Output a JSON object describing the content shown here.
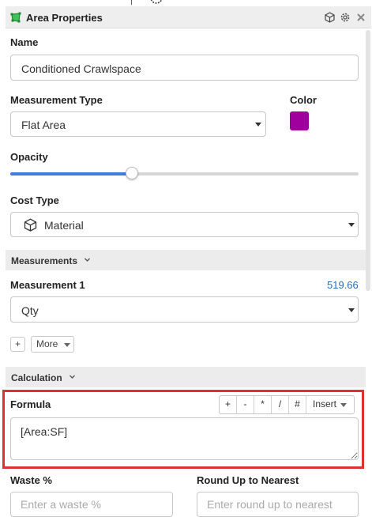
{
  "panel": {
    "title": "Area Properties",
    "title_icon": "area-shape-icon",
    "header_icons": [
      "cube-icon",
      "gear-icon",
      "close-icon"
    ],
    "title_icon_color": "#2fb24a"
  },
  "name": {
    "label": "Name",
    "value": "Conditioned Crawlspace"
  },
  "measurement_type": {
    "label": "Measurement Type",
    "selected": "Flat Area"
  },
  "color": {
    "label": "Color",
    "swatch": "#a0009e"
  },
  "opacity": {
    "label": "Opacity",
    "level": 0.35,
    "accent": "#3b7de0"
  },
  "cost_type": {
    "label": "Cost Type",
    "selected": "Material",
    "icon": "cube-outline-icon"
  },
  "measurements_section": {
    "title": "Measurements"
  },
  "measurement1": {
    "label": "Measurement 1",
    "value": "519.66",
    "selected": "Qty",
    "add_button": "+",
    "more_button": "More"
  },
  "calculation_section": {
    "title": "Calculation"
  },
  "formula": {
    "label": "Formula",
    "operators": [
      "+",
      "-",
      "*",
      "/",
      "#"
    ],
    "insert_label": "Insert",
    "value": "[Area:SF]"
  },
  "waste": {
    "label": "Waste %",
    "placeholder": "Enter a waste %"
  },
  "round_up": {
    "label": "Round Up to Nearest",
    "placeholder": "Enter round up to nearest"
  }
}
